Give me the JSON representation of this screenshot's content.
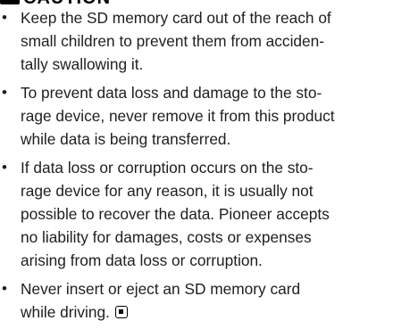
{
  "header": {
    "title": "CAUTION"
  },
  "items": [
    {
      "bullet": "•",
      "lines": [
        "Keep the SD memory card out of the reach of",
        "small children to prevent them from acciden-",
        "tally swallowing it."
      ]
    },
    {
      "bullet": "•",
      "lines": [
        "To prevent data loss and damage to the sto-",
        "rage device, never remove it from this product",
        "while data is being transferred."
      ]
    },
    {
      "bullet": "•",
      "lines": [
        "If data loss or corruption occurs on the sto-",
        "rage device for any reason, it is usually not",
        "possible to recover the data. Pioneer accepts",
        "no liability for damages, costs or expenses",
        "arising from data loss or corruption."
      ]
    },
    {
      "bullet": "•",
      "lines": [
        "Never insert or eject an SD memory card",
        "while driving."
      ]
    }
  ],
  "end_mark_icon": "end-of-section-icon"
}
